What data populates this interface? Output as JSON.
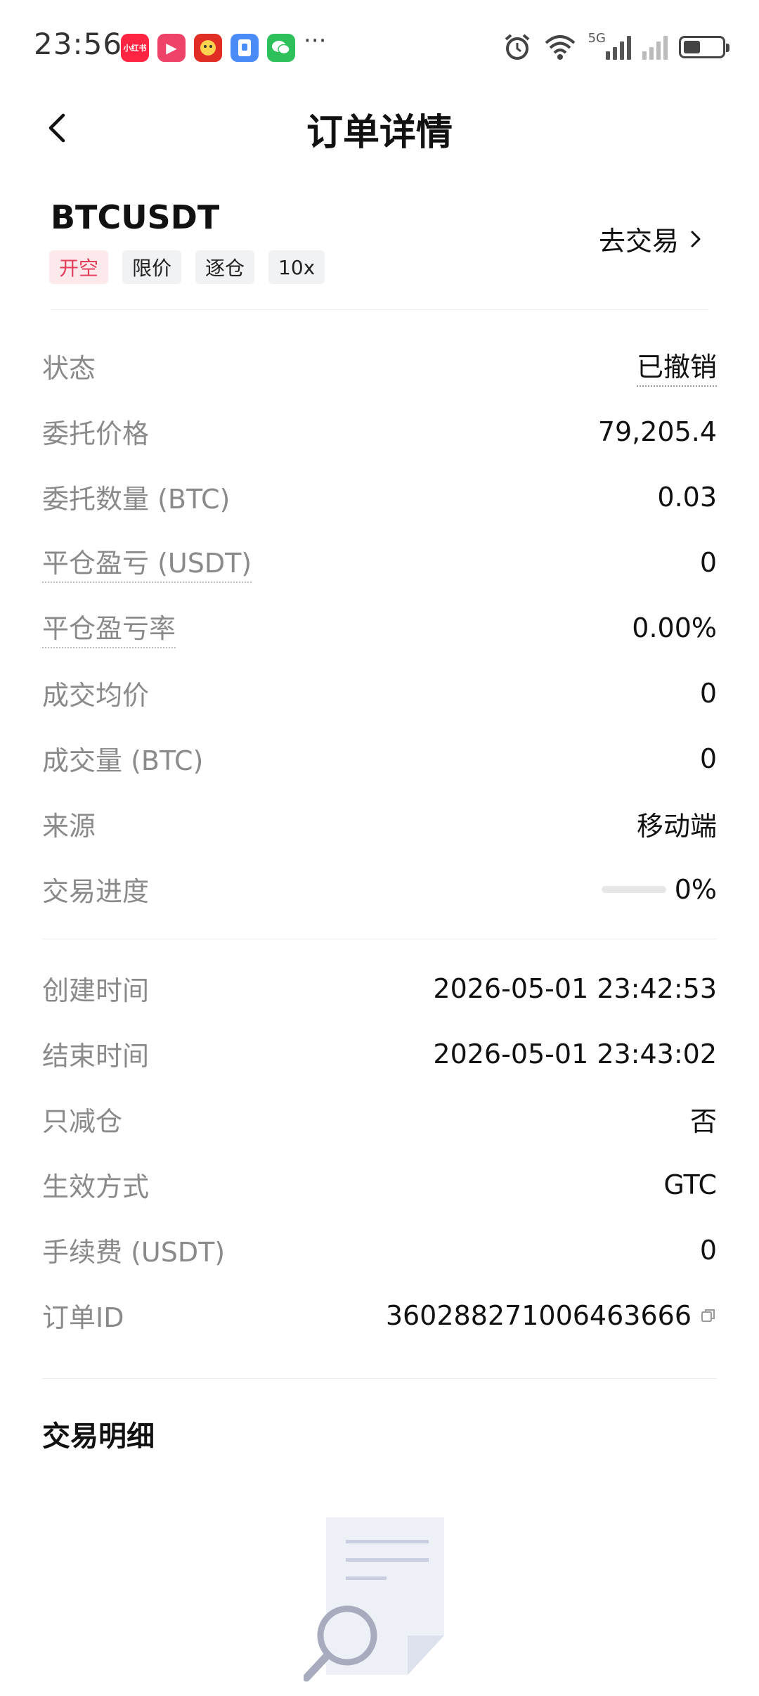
{
  "status_bar": {
    "time": "23:56",
    "network_label": "5G",
    "battery_level": 0.45,
    "apps": [
      {
        "name": "xiaohongshu-icon",
        "color": "#ff2442",
        "text": "小红书"
      },
      {
        "name": "video-app-icon",
        "color": "#f0436a",
        "text": "▶"
      },
      {
        "name": "pinduoduo-icon",
        "color": "#e02e24",
        "text": ""
      },
      {
        "name": "wallet-app-icon",
        "color": "#4a8cf7",
        "text": ""
      },
      {
        "name": "wechat-icon",
        "color": "#2ec05a",
        "text": ""
      }
    ],
    "more": "···"
  },
  "nav": {
    "title": "订单详情"
  },
  "order": {
    "symbol": "BTCUSDT",
    "tags": [
      "开空",
      "限价",
      "逐仓",
      "10x"
    ],
    "trade_link": "去交易"
  },
  "rows_group1": [
    {
      "label": "状态",
      "value": "已撤销"
    },
    {
      "label": "委托价格",
      "value": "79,205.4"
    },
    {
      "label": "委托数量 (BTC)",
      "value": "0.03"
    },
    {
      "label": "平仓盈亏 (USDT)",
      "value": "0"
    },
    {
      "label": "平仓盈亏率",
      "value": "0.00%"
    },
    {
      "label": "成交均价",
      "value": "0"
    },
    {
      "label": "成交量 (BTC)",
      "value": "0"
    },
    {
      "label": "来源",
      "value": "移动端"
    },
    {
      "label": "交易进度",
      "value": "0%",
      "progress": 0
    }
  ],
  "rows_group2": [
    {
      "label": "创建时间",
      "value": "2026-05-01 23:42:53"
    },
    {
      "label": "结束时间",
      "value": "2026-05-01 23:43:02"
    },
    {
      "label": "只减仓",
      "value": "否"
    },
    {
      "label": "生效方式",
      "value": "GTC"
    },
    {
      "label": "手续费 (USDT)",
      "value": "0"
    },
    {
      "label": "订单ID",
      "value": "360288271006463666"
    }
  ],
  "trade_detail": {
    "title": "交易明细"
  },
  "colors": {
    "short_tag_bg": "#fde8ec",
    "short_tag_text": "#e23d5a",
    "label_gray": "#8a8a8a"
  }
}
